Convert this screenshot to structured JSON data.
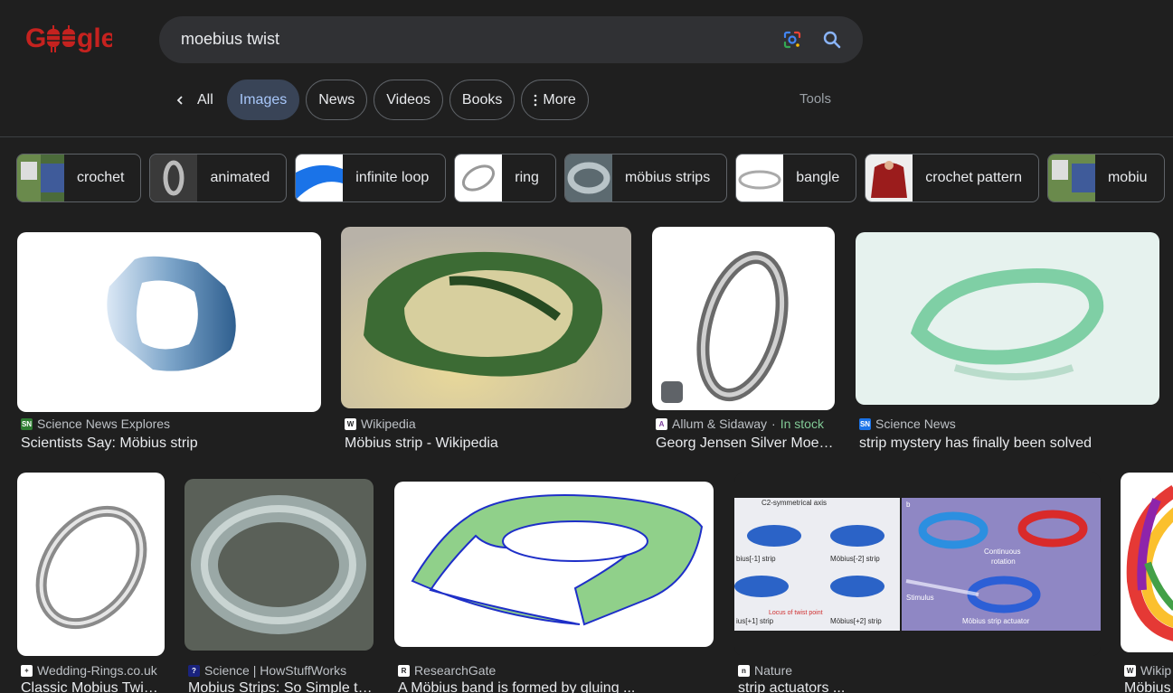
{
  "search": {
    "query": "moebius twist"
  },
  "tabs": {
    "all": "All",
    "images": "Images",
    "news": "News",
    "videos": "Videos",
    "books": "Books",
    "more": "More",
    "tools": "Tools"
  },
  "chips": [
    {
      "label": "crochet"
    },
    {
      "label": "animated"
    },
    {
      "label": "infinite loop"
    },
    {
      "label": "ring"
    },
    {
      "label": "möbius strips"
    },
    {
      "label": "bangle"
    },
    {
      "label": "crochet pattern"
    },
    {
      "label": "mobiu"
    }
  ],
  "results": [
    {
      "source": "Science News Explores",
      "title": "Scientists Say: Möbius strip"
    },
    {
      "source": "Wikipedia",
      "title": "Möbius strip - Wikipedia"
    },
    {
      "source": "Allum & Sidaway",
      "stock": "In stock",
      "title": "Georg Jensen Silver Moe…"
    },
    {
      "source": "Science News",
      "title": "strip mystery has finally been solved"
    },
    {
      "source": "Wedding-Rings.co.uk",
      "title": "Classic Mobius Twi…"
    },
    {
      "source": "Science | HowStuffWorks",
      "title": "Mobius Strips: So Simple t…"
    },
    {
      "source": "ResearchGate",
      "title": "A Möbius band is formed by gluing ..."
    },
    {
      "source": "Nature",
      "title": "strip actuators ..."
    },
    {
      "source": "Wikip",
      "title": "Möbius"
    }
  ],
  "figure_text": {
    "panel_b": "b",
    "axis": "C2-symmetrical axis",
    "strip_m1": "bius[-1] strip",
    "strip_m2": "Möbius[-2] strip",
    "strip_p1": "ius[+1] strip",
    "strip_p2": "Möbius[+2] strip",
    "locus": "Locus of twist point",
    "continuous": "Continuous",
    "rotation": "rotation",
    "stimulus": "Stimulus",
    "actuator": "Möbius strip actuator"
  },
  "colors": {
    "accent": "#a8c7fa",
    "stock_green": "#81c995"
  }
}
